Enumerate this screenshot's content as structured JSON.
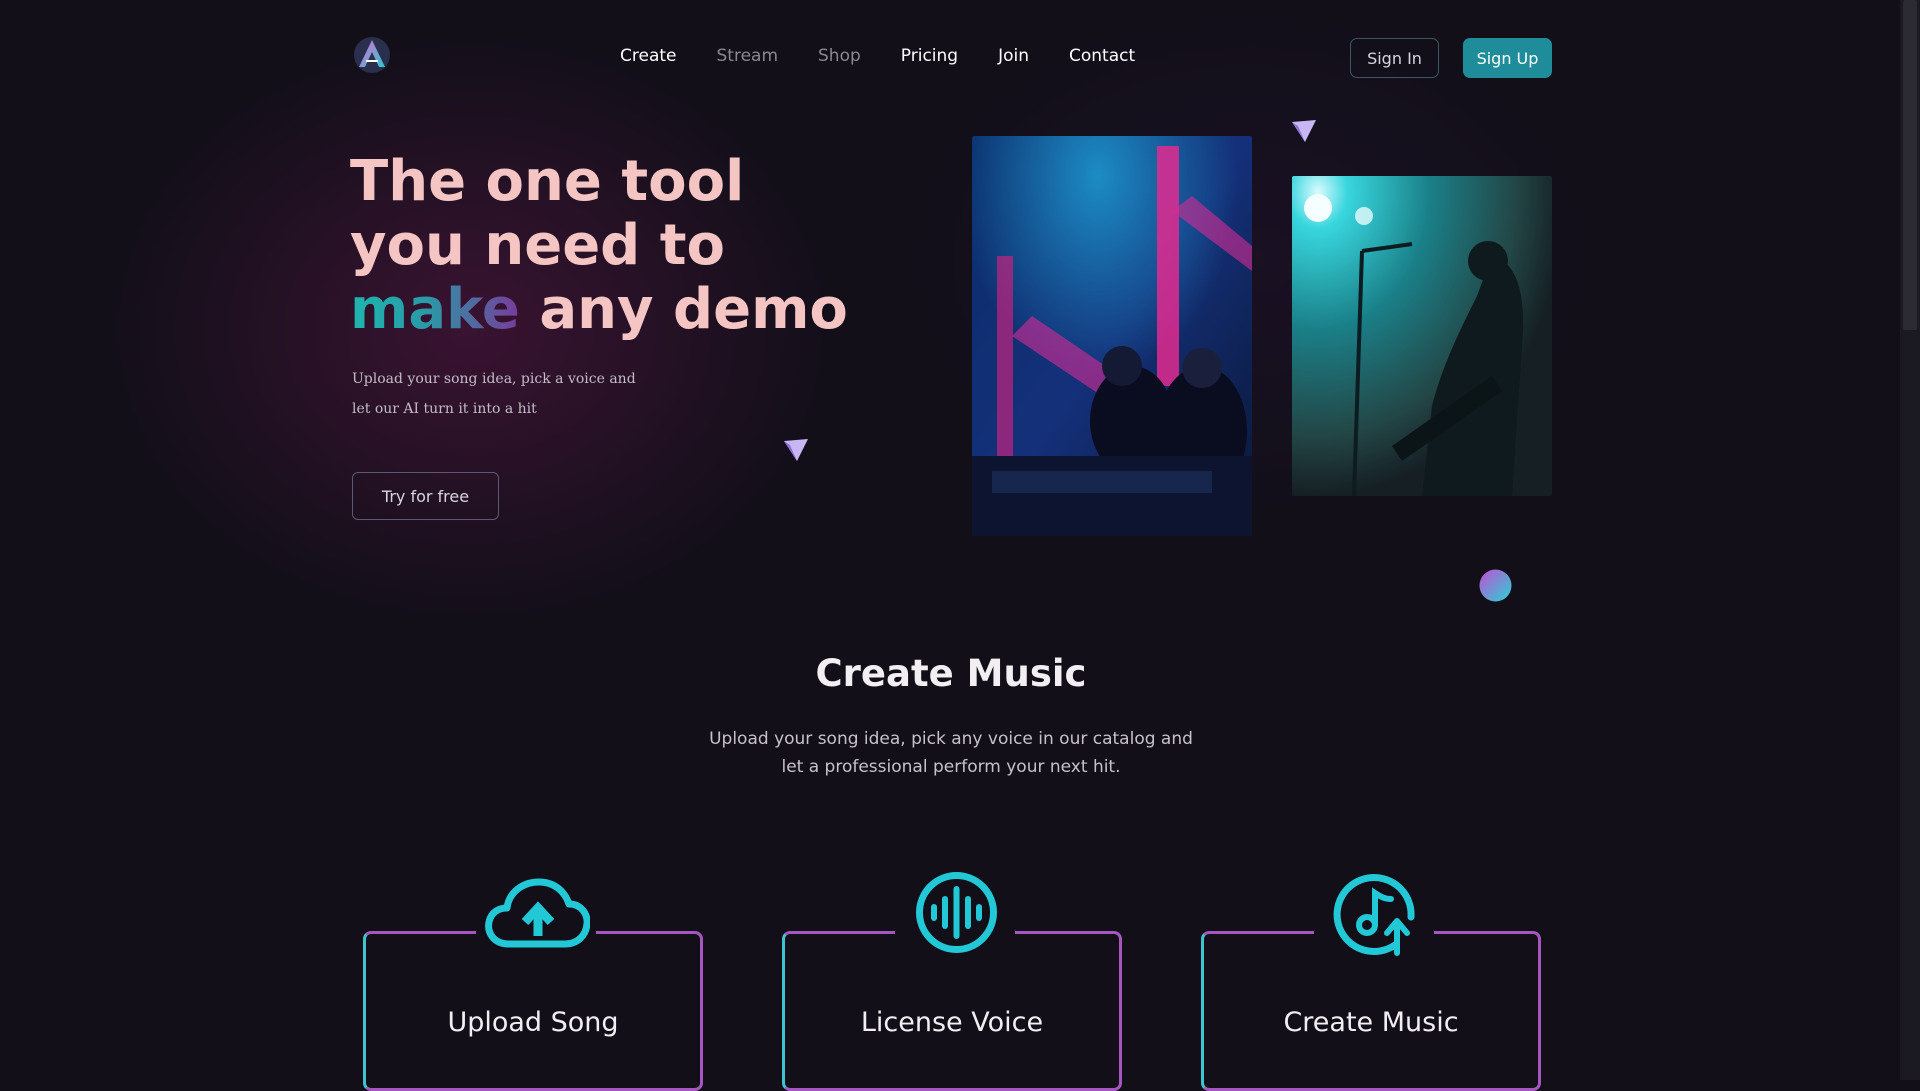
{
  "header": {
    "logo": "a-logo-icon",
    "nav": [
      {
        "label": "Create",
        "dim": false
      },
      {
        "label": "Stream",
        "dim": true
      },
      {
        "label": "Shop",
        "dim": true
      },
      {
        "label": "Pricing",
        "dim": false
      },
      {
        "label": "Join",
        "dim": false
      },
      {
        "label": "Contact",
        "dim": false
      }
    ],
    "sign_in": "Sign In",
    "sign_up": "Sign Up"
  },
  "hero": {
    "title_line1": "The one tool",
    "title_line2": "you need to",
    "title_highlight": "make",
    "title_line3_rest": " any demo",
    "subtitle_line1": "Upload your song idea, pick a voice and",
    "subtitle_line2": "let our AI turn it into a hit",
    "cta": "Try for free"
  },
  "images": [
    {
      "name": "dj-duo-photo",
      "icon": "dj-photo"
    },
    {
      "name": "singer-guitar-photo",
      "icon": "concert-photo"
    }
  ],
  "section": {
    "title": "Create Music",
    "description": "Upload your song idea, pick any voice in our catalog and let a professional perform your next hit."
  },
  "cards": [
    {
      "label": "Upload Song",
      "icon": "cloud-upload-icon"
    },
    {
      "label": "License Voice",
      "icon": "sound-wave-icon"
    },
    {
      "label": "Create Music",
      "icon": "music-note-upload-icon"
    }
  ],
  "colors": {
    "background": "#120f19",
    "accent_teal": "#1f8c99",
    "title_pink": "#f5c5c3",
    "icon_cyan": "#22c8d6",
    "card_border_purple": "#a656c0"
  }
}
